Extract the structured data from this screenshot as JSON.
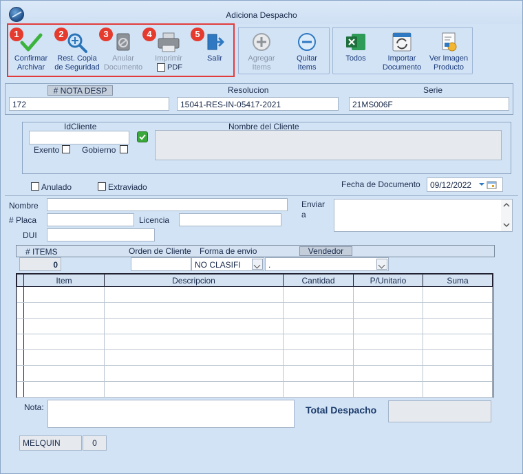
{
  "window": {
    "title": "Adiciona Despacho"
  },
  "toolbar": {
    "badges": [
      "1",
      "2",
      "3",
      "4",
      "5"
    ],
    "confirm": {
      "line1": "Confirmar",
      "line2": "Archivar",
      "icon": "check-icon"
    },
    "restore": {
      "line1": "Rest. Copia",
      "line2": "de Seguridad",
      "icon": "magnify-plus-icon"
    },
    "void": {
      "line1": "Anular",
      "line2": "Documento",
      "icon": "void-document-icon"
    },
    "print": {
      "line1": "Imprimir",
      "pdf_label": "PDF",
      "icon": "printer-icon"
    },
    "exit": {
      "line1": "Salir",
      "icon": "exit-door-icon"
    },
    "add_items": {
      "line1": "Agregar",
      "line2": "Items",
      "icon": "plus-circle-icon"
    },
    "remove_items": {
      "line1": "Quitar",
      "line2": "Items",
      "icon": "minus-circle-icon"
    },
    "all": {
      "line1": "Todos",
      "icon": "excel-icon"
    },
    "import": {
      "line1": "Importar",
      "line2": "Documento",
      "icon": "import-refresh-icon"
    },
    "product_image": {
      "line1": "Ver Imagen",
      "line2": "Producto",
      "icon": "invoice-icon"
    }
  },
  "header": {
    "nota_label": "# NOTA DESP",
    "nota_value": "172",
    "resolucion_label": "Resolucion",
    "resolucion_value": "15041-RES-IN-05417-2021",
    "serie_label": "Serie",
    "serie_value": "21MS006F"
  },
  "client": {
    "id_label": "IdCliente",
    "id_value": "",
    "name_label": "Nombre del Cliente",
    "name_value": "",
    "exento_label": "Exento",
    "gobierno_label": "Gobierno"
  },
  "status": {
    "anulado_label": "Anulado",
    "extraviado_label": "Extraviado",
    "fecha_label": "Fecha de Documento",
    "fecha_value": "09/12/2022"
  },
  "delivery": {
    "nombre_label": "Nombre",
    "placa_label": "# Placa",
    "licencia_label": "Licencia",
    "dui_label": "DUI",
    "enviar_label_1": "Enviar",
    "enviar_label_2": "a"
  },
  "order": {
    "items_label": "# ITEMS",
    "items_value": "0",
    "orden_label": "Orden de Cliente",
    "forma_label": "Forma de envio",
    "forma_value": "NO CLASIFI",
    "vendedor_label": "Vendedor",
    "vendedor_value": "."
  },
  "grid": {
    "columns": [
      "Item",
      "Descripcion",
      "Cantidad",
      "P/Unitario",
      "Suma"
    ]
  },
  "footer": {
    "nota_label": "Nota:",
    "total_label": "Total Despacho",
    "user_value": "MELQUIN",
    "user_count": "0"
  },
  "colors": {
    "highlight": "#e23b3b",
    "badge": "#e53a2e",
    "background": "#d2e3f6"
  }
}
